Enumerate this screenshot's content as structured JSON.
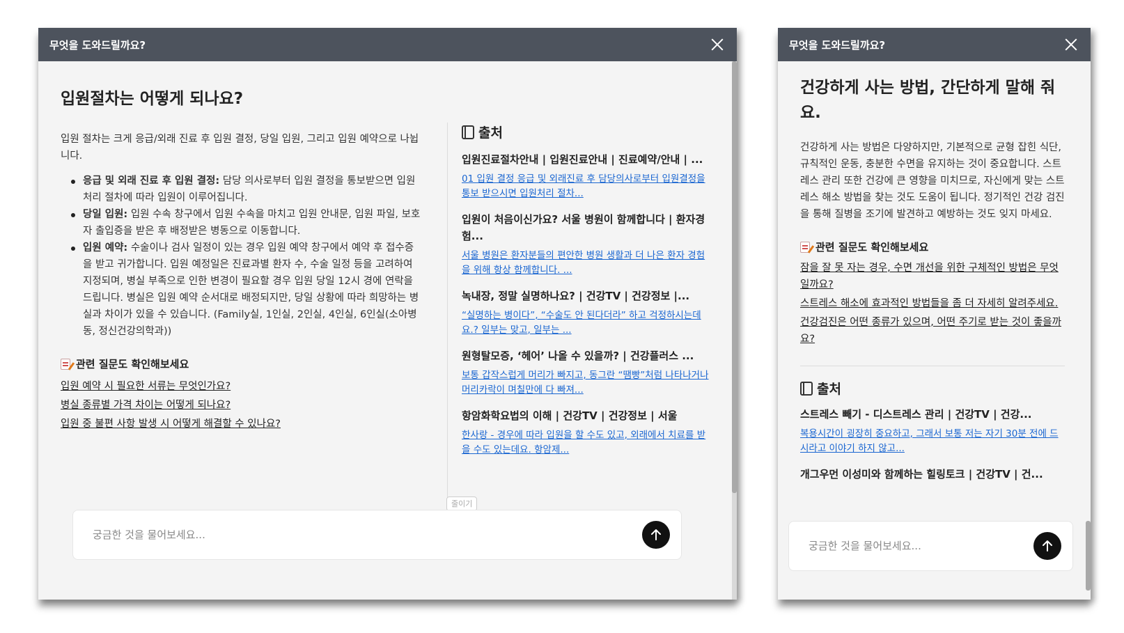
{
  "left_panel": {
    "header_title": "무엇을 도와드릴까요?",
    "question": "입원절차는 어떻게 되나요?",
    "intro": "입원 절차는 크게 응급/외래 진료 후 입원 결정, 당일 입원, 그리고 입원 예약으로 나뉩니다.",
    "bullets": [
      {
        "term": "응급 및 외래 진료 후 입원 결정:",
        "text": " 담당 의사로부터 입원 결정을 통보받으면 입원 처리 절차에 따라 입원이 이루어집니다."
      },
      {
        "term": "당일 입원:",
        "text": " 입원 수속 창구에서 입원 수속을 마치고 입원 안내문, 입원 파일, 보호자 출입증을 받은 후 배정받은 병동으로 이동합니다."
      },
      {
        "term": "입원 예약:",
        "text": " 수술이나 검사 일정이 있는 경우 입원 예약 창구에서 예약 후 접수증을 받고 귀가합니다. 입원 예정일은 진료과별 환자 수, 수술 일정 등을 고려하여 지정되며, 병실 부족으로 인한 변경이 필요할 경우 입원 당일 12시 경에 연락을 드립니다. 병실은 입원 예약 순서대로 배정되지만, 당일 상황에 따라 희망하는 병실과 차이가 있을 수 있습니다. (Family실, 1인실, 2인실, 4인실, 6인실(소아병동, 정신건강의학과))"
      }
    ],
    "related_title": "관련 질문도 확인해보세요",
    "related_questions": [
      "입원 예약 시 필요한 서류는 무엇인가요?",
      "병실 종류별 가격 차이는 어떻게 되나요?",
      "입원 중 불편 사항 발생 시 어떻게 해결할 수 있나요?"
    ],
    "sources_title": "출처",
    "sources": [
      {
        "title": "입원진료절차안내 | 입원진료안내 | 진료예약/안내 | ...",
        "snippet": "01 입원 결정 응급 및 외래진료 후 담당의사로부터 입원결정을 통보 받으시면 입원처리 절차..."
      },
      {
        "title": "입원이 처음이신가요? 서울 병원이 함께합니다 | 환자경험...",
        "snippet": "서울 병원은 환자분들의 편안한 병원 생활과 더 나은 환자 경험을 위해 항상 함께합니다. ..."
      },
      {
        "title": "녹내장, 정말 실명하나요? | 건강TV | 건강정보 |...",
        "snippet": "“실명하는 병이다”, “수술도 안 된다더라” 하고 걱정하시는데요.? 일부는 맞고, 일부는 ..."
      },
      {
        "title": "원형탈모증, ‘헤어’ 나올 수 있을까? | 건강플러스 ...",
        "snippet": "보통 갑작스럽게 머리가 빠지고, 동그란 “땜빵”처럼 나타나거나 머리카락이 며칠만에 다 빠져..."
      },
      {
        "title": "항암화학요법의 이해 | 건강TV | 건강정보 | 서울",
        "snippet": "한사랑 - 경우에 따라 입원을 할 수도 있고, 외래에서 치료를 받을 수도 있는데요. 항암제..."
      }
    ],
    "collapse_label": "줄이기",
    "input_placeholder": "궁금한 것을 물어보세요..."
  },
  "right_panel": {
    "header_title": "무엇을 도와드릴까요?",
    "question": "건강하게 사는 방법, 간단하게 말해 줘요.",
    "answer": "건강하게 사는 방법은 다양하지만, 기본적으로 균형 잡힌 식단, 규칙적인 운동, 충분한 수면을 유지하는 것이 중요합니다. 스트레스 관리 또한 건강에 큰 영향을 미치므로, 자신에게 맞는 스트레스 해소 방법을 찾는 것도 도움이 됩니다. 정기적인 건강 검진을 통해 질병을 조기에 발견하고 예방하는 것도 잊지 마세요.",
    "related_title": "관련 질문도 확인해보세요",
    "related_questions": [
      "잠을 잘 못 자는 경우, 수면 개선을 위한 구체적인 방법은 무엇일까요?",
      "스트레스 해소에 효과적인 방법들을 좀 더 자세히 알려주세요.",
      "건강검진은 어떤 종류가 있으며, 어떤 주기로 받는 것이 좋을까요?"
    ],
    "sources_title": "출처",
    "sources": [
      {
        "title": "스트레스 빼기 - 디스트레스 관리 | 건강TV | 건강...",
        "snippet": "복용시간이 굉장히 중요하고, 그래서 보통 저는 자기 30분 전에 드시라고 이야기 하지 않고..."
      },
      {
        "title": "개그우먼 이성미와 함께하는 힐링토크 | 건강TV | 건...",
        "snippet": ""
      }
    ],
    "input_placeholder": "궁금한 것을 물어보세요..."
  },
  "icons": [
    "close-icon",
    "memo-icon",
    "book-icon",
    "arrow-up-icon"
  ],
  "colors": {
    "header_bg": "#4d535d",
    "panel_bg": "#f4f4f4",
    "link_blue": "#1a66d1",
    "send_button": "#111111"
  }
}
